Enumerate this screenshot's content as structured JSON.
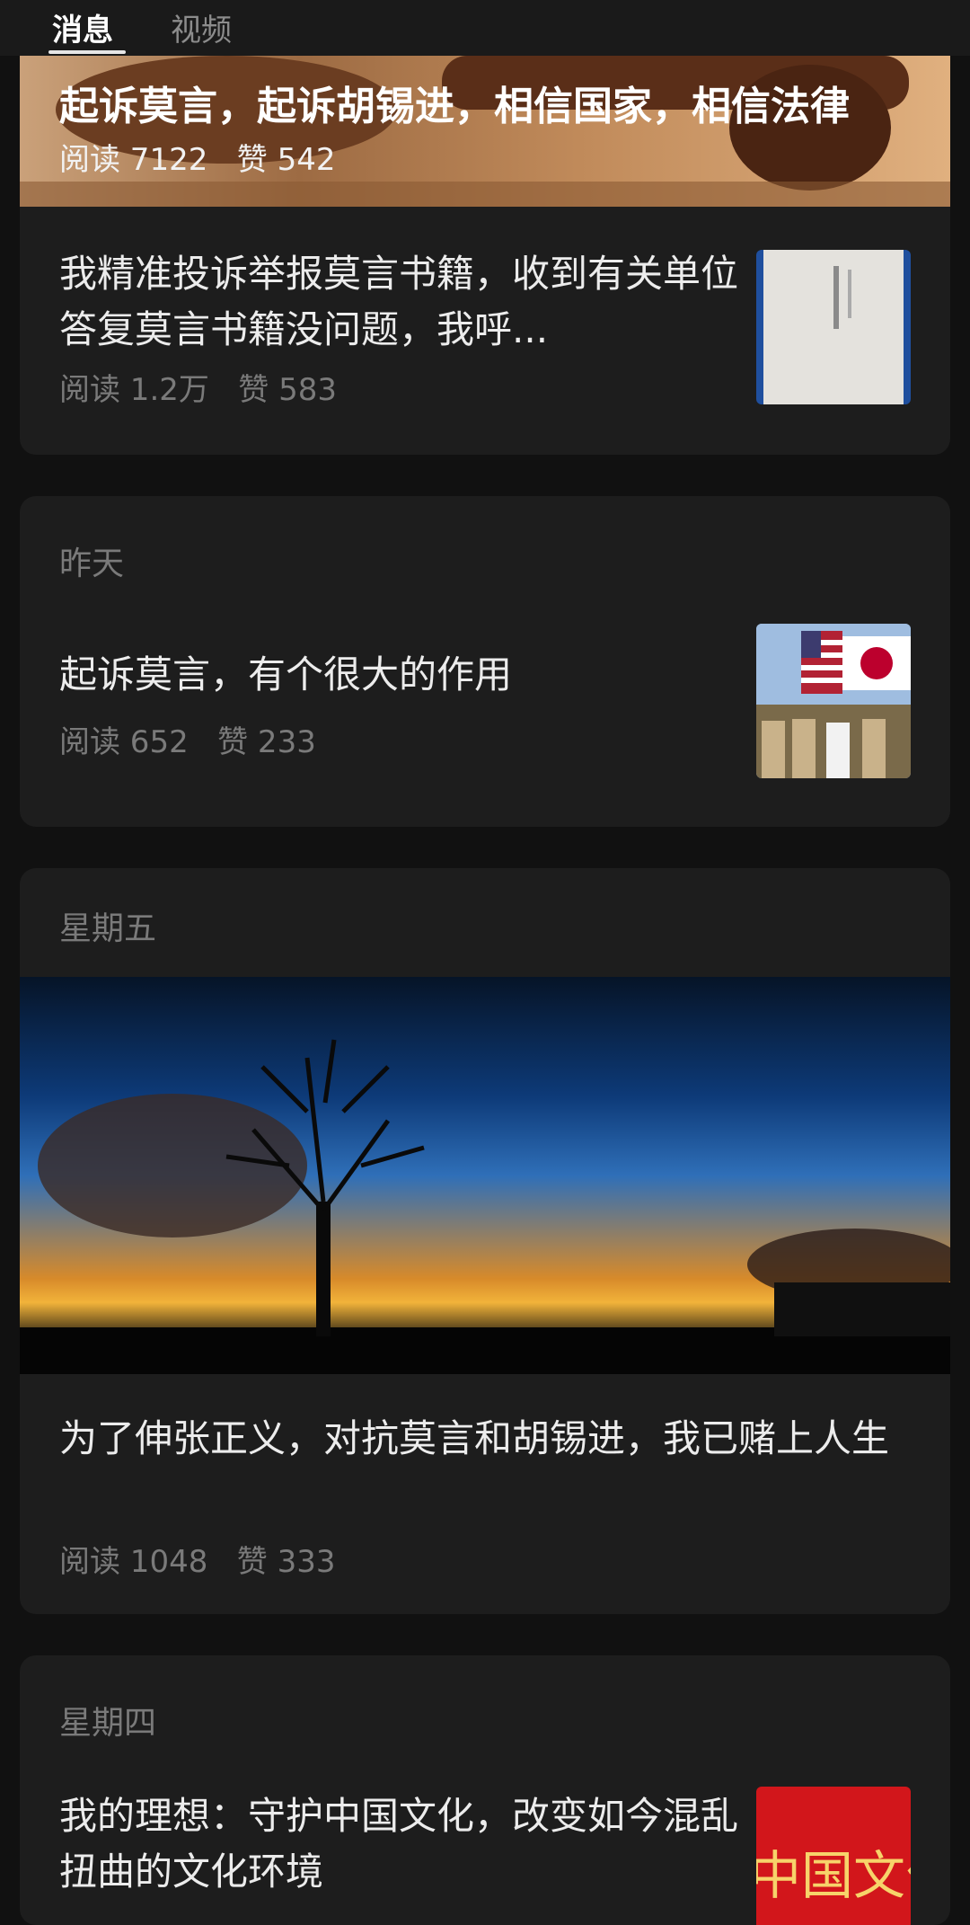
{
  "tabs": [
    {
      "label": "消息",
      "active": true
    },
    {
      "label": "视频",
      "active": false
    }
  ],
  "hero": {
    "title": "起诉莫言，起诉胡锡进，相信国家，相信法律",
    "meta": "阅读 7122   赞 542"
  },
  "cards": [
    {
      "title": "我精准投诉举报莫言书籍，收到有关单位答复莫言书籍没问题，我呼...",
      "meta": "阅读 1.2万   赞 583"
    },
    {
      "date": "昨天",
      "title": "起诉莫言，有个很大的作用",
      "meta": "阅读 652   赞 233"
    },
    {
      "date": "星期五",
      "title": "为了伸张正义，对抗莫言和胡锡进，我已赌上人生",
      "meta": "阅读 1048   赞 333"
    },
    {
      "date": "星期四",
      "title": "我的理想：守护中国文化，改变如今混乱扭曲的文化环境",
      "thumb_text": "中国文化"
    }
  ],
  "colors": {
    "background": "#111111",
    "card": "#1d1d1d",
    "text": "#ececec",
    "muted": "#7a7a7a"
  }
}
